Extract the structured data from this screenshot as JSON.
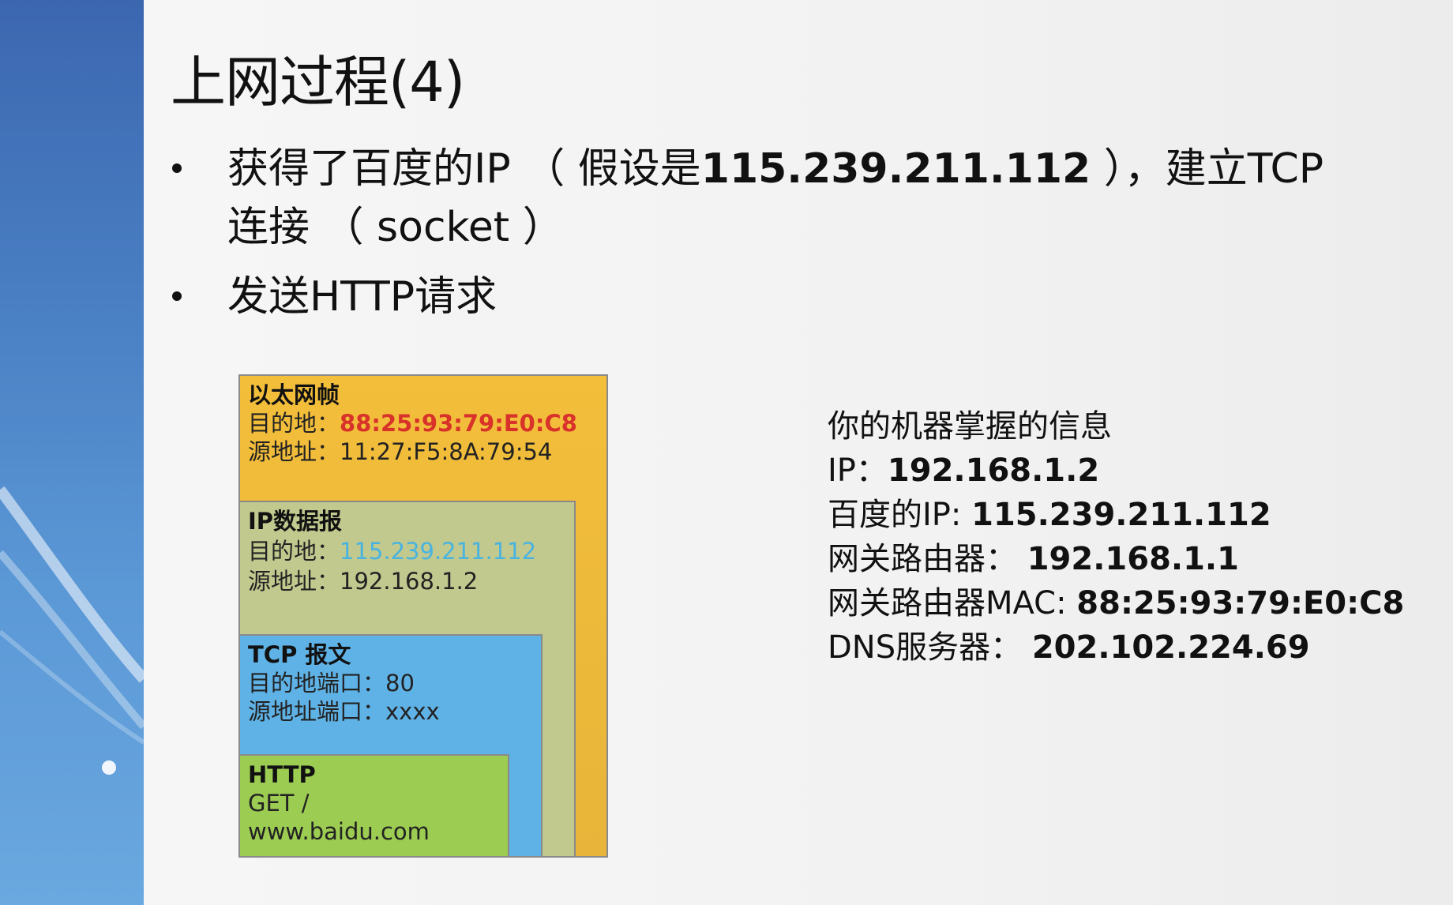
{
  "slide": {
    "title": "上网过程(4)",
    "bullets": [
      {
        "line1_prefix": "获得了百度的IP （ 假设是",
        "line1_bold": "115.239.211.112",
        "line1_suffix": " ），建立TCP",
        "line2": "连接 （ socket ）"
      },
      {
        "text": "发送HTTP请求"
      }
    ]
  },
  "diagram": {
    "ethernet": {
      "title": "以太网帧",
      "dest_label": "目的地：",
      "dest_value": "88:25:93:79:E0:C8",
      "src": "源地址：11:27:F5:8A:79:54"
    },
    "ip": {
      "title": "IP数据报",
      "dest_label": "目的地：",
      "dest_value": "115.239.211.112",
      "src": "源地址：192.168.1.2"
    },
    "tcp": {
      "title": "TCP 报文",
      "dest_port": "目的地端口：80",
      "src_port": "源地址端口：xxxx"
    },
    "http": {
      "title": "HTTP",
      "line1": "GET /",
      "line2": "www.baidu.com"
    },
    "colors": {
      "ethernet": "#f3be3a",
      "ip": "#c1c98e",
      "tcp": "#5fb2e6",
      "http": "#9ccc52",
      "mac_highlight": "#d8322a",
      "ip_highlight": "#49b3e0"
    }
  },
  "info": {
    "heading": "你的机器掌握的信息",
    "rows": [
      {
        "label": "IP：",
        "value": "192.168.1.2"
      },
      {
        "label": "百度的IP: ",
        "value": "115.239.211.112"
      },
      {
        "label": "网关路由器： ",
        "value": "192.168.1.1"
      },
      {
        "label": "网关路由器MAC: ",
        "value": "88:25:93:79:E0:C8"
      },
      {
        "label": "DNS服务器： ",
        "value": "202.102.224.69"
      }
    ]
  }
}
